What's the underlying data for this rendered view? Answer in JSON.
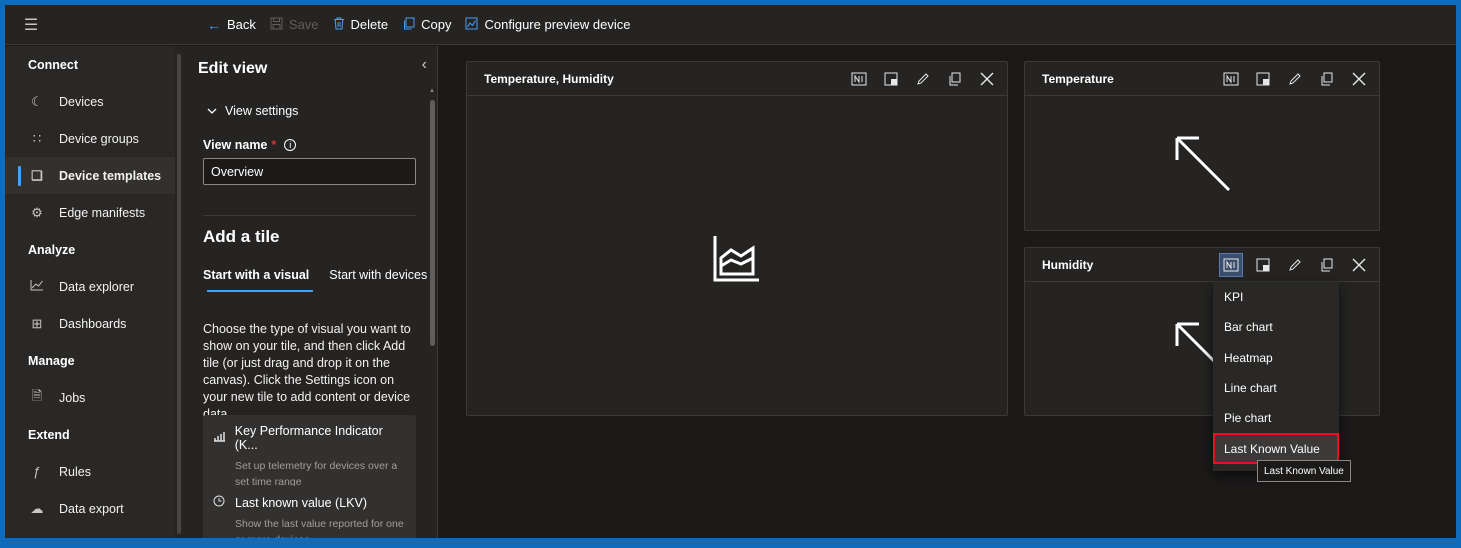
{
  "toolbar": {
    "back_label": "Back",
    "save_label": "Save",
    "delete_label": "Delete",
    "copy_label": "Copy",
    "configure_label": "Configure preview device"
  },
  "nav": {
    "sections": [
      {
        "title": "Connect",
        "items": [
          {
            "label": "Devices",
            "icon": "devices-icon",
            "active": false
          },
          {
            "label": "Device groups",
            "icon": "device-groups-icon",
            "active": false
          },
          {
            "label": "Device templates",
            "icon": "device-templates-icon",
            "active": true
          },
          {
            "label": "Edge manifests",
            "icon": "edge-manifests-icon",
            "active": false
          }
        ]
      },
      {
        "title": "Analyze",
        "items": [
          {
            "label": "Data explorer",
            "icon": "data-explorer-icon",
            "active": false
          },
          {
            "label": "Dashboards",
            "icon": "dashboards-icon",
            "active": false
          }
        ]
      },
      {
        "title": "Manage",
        "items": [
          {
            "label": "Jobs",
            "icon": "jobs-icon",
            "active": false
          }
        ]
      },
      {
        "title": "Extend",
        "items": [
          {
            "label": "Rules",
            "icon": "rules-icon",
            "active": false
          },
          {
            "label": "Data export",
            "icon": "data-export-icon",
            "active": false
          }
        ]
      }
    ]
  },
  "edit_panel": {
    "title": "Edit view",
    "view_settings_label": "View settings",
    "view_name_label": "View name",
    "required_mark": "*",
    "view_name_value": "Overview",
    "add_tile_title": "Add a tile",
    "tabs": [
      {
        "label": "Start with a visual",
        "active": true
      },
      {
        "label": "Start with devices",
        "active": false
      }
    ],
    "description": "Choose the type of visual you want to show on your tile, and then click Add tile (or just drag and drop it on the canvas). Click the Settings icon on your new tile to add content or device data.",
    "visuals": [
      {
        "title": "Key Performance Indicator (K...",
        "description": "Set up telemetry for devices over a set time range"
      },
      {
        "title": "Last known value (LKV)",
        "description": "Show the last value reported for one or more devices"
      }
    ]
  },
  "tiles": {
    "temp_humidity": {
      "title": "Temperature, Humidity"
    },
    "temperature": {
      "title": "Temperature"
    },
    "humidity": {
      "title": "Humidity"
    }
  },
  "visual_menu": {
    "items": [
      "KPI",
      "Bar chart",
      "Heatmap",
      "Line chart",
      "Pie chart",
      "Last Known Value"
    ],
    "selected_index": 5,
    "tooltip": "Last Known Value"
  },
  "colors": {
    "accent": "#479ef5",
    "selection_outline": "#e81123",
    "window_border": "#0f6cbd"
  }
}
